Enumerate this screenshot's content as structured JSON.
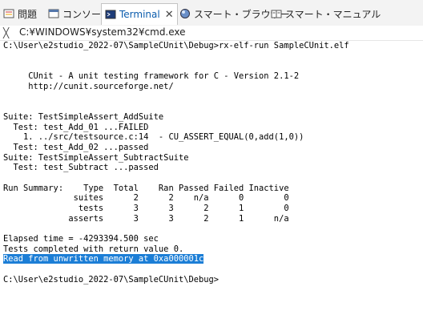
{
  "tabs": [
    {
      "label": "問題",
      "icon": "problems-icon"
    },
    {
      "label": "コンソール",
      "icon": "console-icon"
    },
    {
      "label": "Terminal",
      "icon": "terminal-icon",
      "active": true
    },
    {
      "label": "スマート・ブラウザー",
      "icon": "smart-browser-icon"
    },
    {
      "label": "スマート・マニュアル",
      "icon": "smart-manual-icon"
    }
  ],
  "terminal_tab": {
    "title": "C:¥WINDOWS¥system32¥cmd.exe",
    "close_glyph": "╳"
  },
  "terminal_lines": [
    "C:\\User\\e2studio_2022-07\\SampleCUnit\\Debug>rx-elf-run SampleCUnit.elf",
    "",
    "",
    "     CUnit - A unit testing framework for C - Version 2.1-2",
    "     http://cunit.sourceforge.net/",
    "",
    "",
    "Suite: TestSimpleAssert_AddSuite",
    "  Test: test_Add_01 ...FAILED",
    "    1. ../src/testsource.c:14  - CU_ASSERT_EQUAL(0,add(1,0))",
    "  Test: test_Add_02 ...passed",
    "Suite: TestSimpleAssert_SubtractSuite",
    "  Test: test_Subtract ...passed",
    "",
    "Run Summary:    Type  Total    Ran Passed Failed Inactive",
    "              suites      2      2    n/a      0        0",
    "               tests      3      3      2      1        0",
    "             asserts      3      3      2      1      n/a",
    "",
    "Elapsed time = -4293394.500 sec",
    "Tests completed with return value 0.",
    "Read from unwritten memory at 0xa000001c",
    "",
    "C:\\User\\e2studio_2022-07\\SampleCUnit\\Debug>"
  ],
  "selected_line_index": 21,
  "colors": {
    "selection": "#1c7ed6",
    "active_tab_text": "#0b5cad"
  }
}
